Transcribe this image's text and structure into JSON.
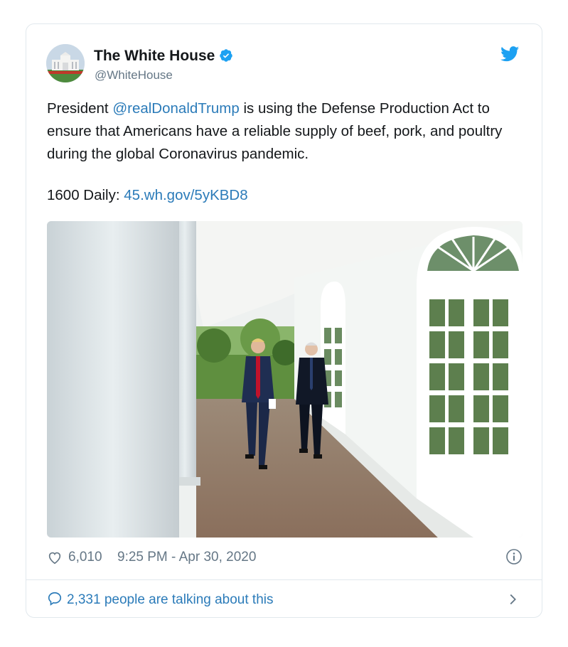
{
  "account": {
    "name": "The White House",
    "handle": "@WhiteHouse"
  },
  "tweet": {
    "text_before": "President ",
    "mention": "@realDonaldTrump",
    "text_after": " is using the Defense Production Act to ensure that Americans have a reliable supply of beef, pork, and poultry during the global Coronavirus pandemic.",
    "source_prefix": "1600 Daily: ",
    "link": "45.wh.gov/5yKBD8"
  },
  "footer": {
    "likes": "6,010",
    "timestamp": "9:25 PM - Apr 30, 2020",
    "talking": "2,331 people are talking about this"
  },
  "colors": {
    "link": "#2b7bb9",
    "verified": "#1da1f2",
    "muted": "#657786",
    "border": "#e1e8ed"
  },
  "icons": [
    "twitter-bird-icon",
    "verified-badge-icon",
    "heart-icon",
    "info-icon",
    "comment-bubble-icon",
    "chevron-right-icon"
  ]
}
